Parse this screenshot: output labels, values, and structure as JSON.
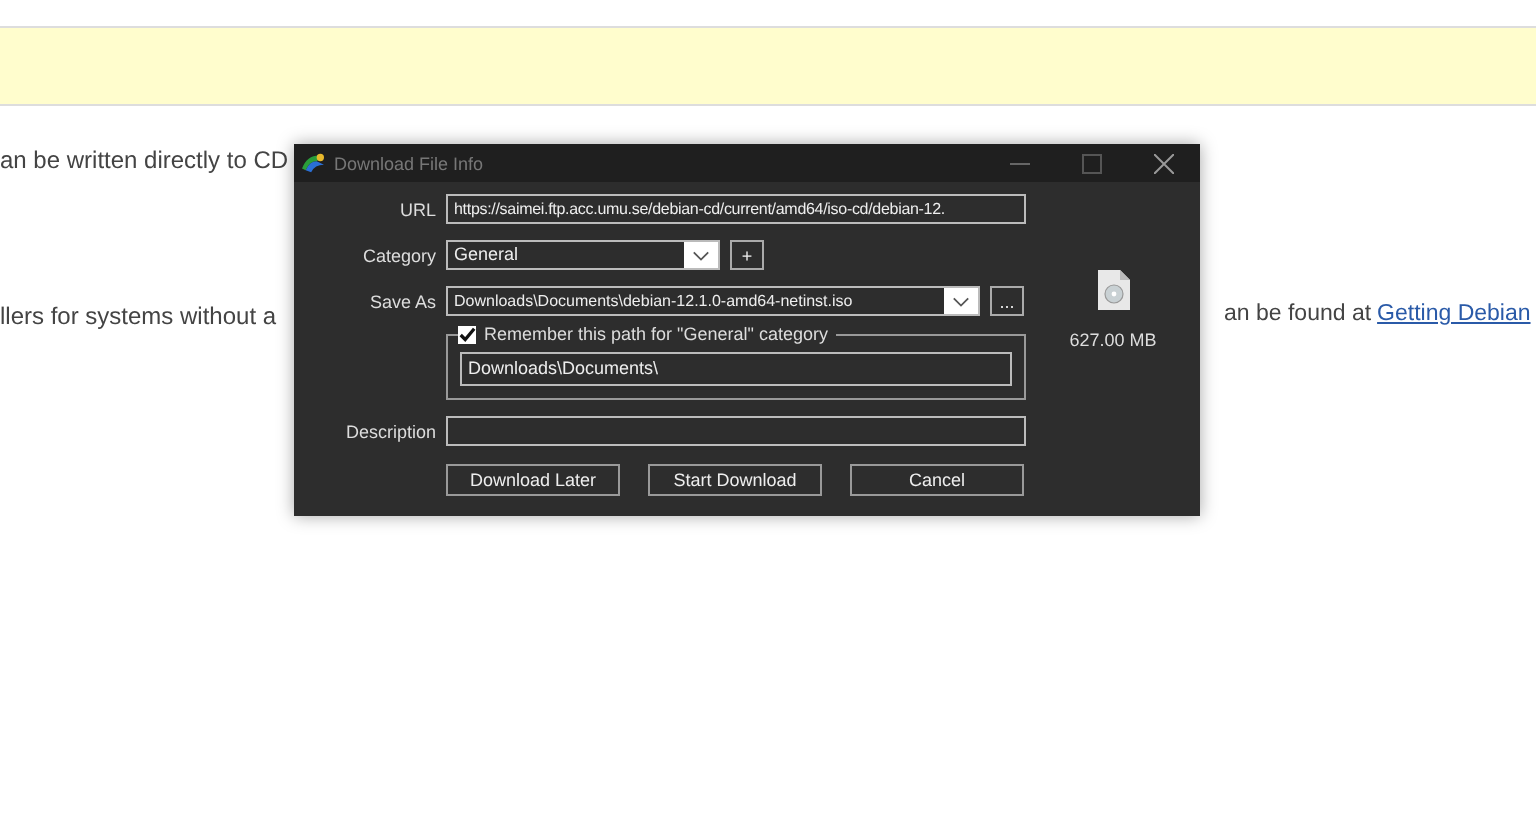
{
  "page": {
    "line_1": "an be written directly to CD",
    "line_2": "llers for systems without a",
    "line_3": "an be found at",
    "link": "Getting Debian"
  },
  "dialog": {
    "title": "Download File Info",
    "url": {
      "label": "URL",
      "value": "https://saimei.ftp.acc.umu.se/debian-cd/current/amd64/iso-cd/debian-12."
    },
    "category": {
      "label": "Category",
      "value": "General",
      "add": "+"
    },
    "save_as": {
      "label": "Save As",
      "value": "Downloads\\Documents\\debian-12.1.0-amd64-netinst.iso",
      "browse": "..."
    },
    "remember": {
      "label": "Remember this path for \"General\" category",
      "checked": true,
      "path": "Downloads\\Documents\\"
    },
    "description": {
      "label": "Description"
    },
    "file_size": "627.00  MB",
    "buttons": [
      "Download Later",
      "Start Download",
      "Cancel"
    ]
  }
}
